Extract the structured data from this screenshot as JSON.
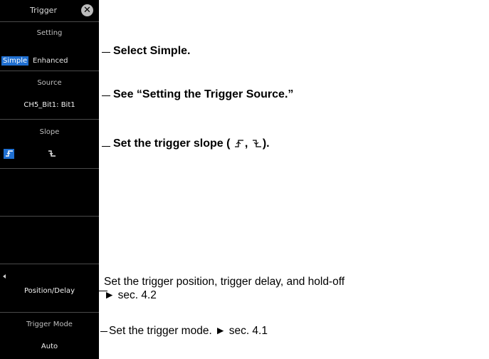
{
  "panel": {
    "title": "Trigger",
    "close_icon": "close-icon",
    "setting": {
      "label": "Setting",
      "options": [
        "Simple",
        "Enhanced"
      ],
      "selected": "Simple"
    },
    "source": {
      "label": "Source",
      "value": "CH5_Bit1: Bit1"
    },
    "slope": {
      "label": "Slope",
      "options": [
        "rising-edge-icon",
        "falling-edge-icon"
      ],
      "selected": "rising-edge-icon"
    },
    "position_delay": {
      "label": "Position/Delay"
    },
    "trigger_mode": {
      "label": "Trigger Mode",
      "value": "Auto"
    },
    "accent": "#1f6fd1"
  },
  "callouts": {
    "setting": "Select Simple.",
    "source": "See “Setting the Trigger Source.”",
    "slope_prefix": "Set the trigger slope (",
    "slope_sep": ",",
    "slope_suffix": ").",
    "position_line1": "Set the trigger position, trigger delay, and hold-off",
    "position_line2": "► sec. 4.2",
    "mode": "Set the trigger mode. ► sec. 4.1"
  }
}
